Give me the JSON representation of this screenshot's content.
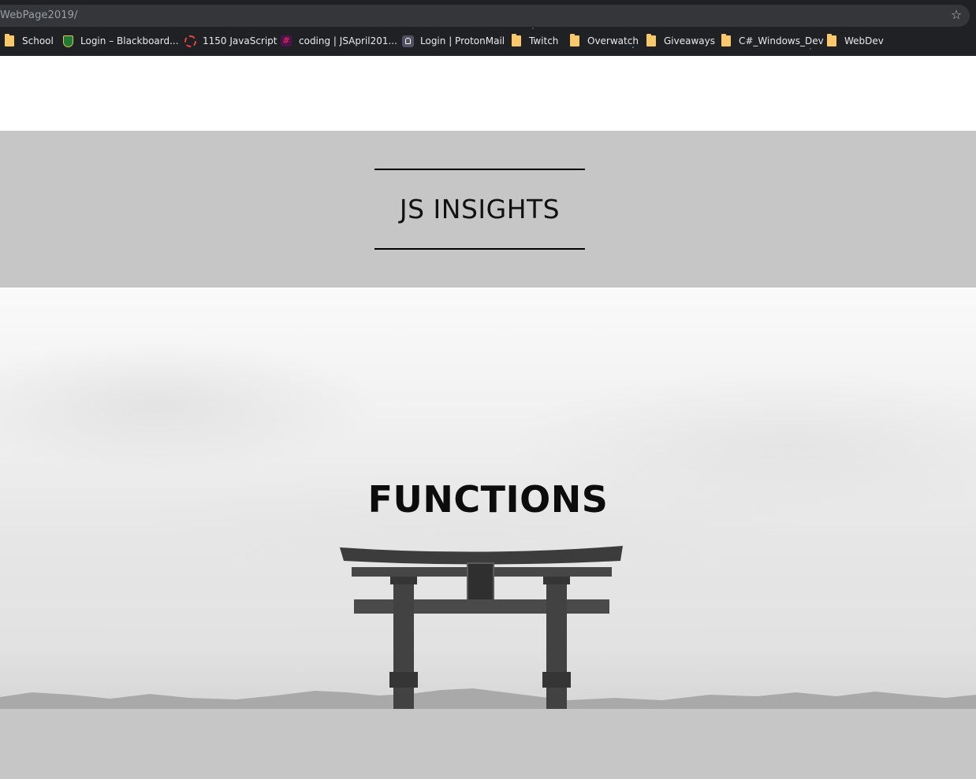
{
  "browser": {
    "url": "WebPage2019/",
    "bookmark_star": "bookmark-star-icon",
    "bookmarks": [
      {
        "label": "School",
        "icon": "folder-icon"
      },
      {
        "label": "Login – Blackboard...",
        "icon": "blackboard-shield-icon"
      },
      {
        "label": "1150 JavaScript",
        "icon": "red-ring-icon"
      },
      {
        "label": "coding | JSApril201...",
        "icon": "slack-icon"
      },
      {
        "label": "Login | ProtonMail",
        "icon": "protonmail-lock-icon"
      },
      {
        "label": "Twitch",
        "icon": "folder-icon"
      },
      {
        "label": "Overwatch",
        "icon": "folder-icon"
      },
      {
        "label": "Giveaways",
        "icon": "folder-icon"
      },
      {
        "label": "C#_Windows_Dev",
        "icon": "folder-icon"
      },
      {
        "label": "WebDev",
        "icon": "folder-icon"
      }
    ]
  },
  "header": {
    "title": "JS INSIGHTS"
  },
  "hero": {
    "title": "FUNCTIONS",
    "image": "torii-gate-on-water-grayscale"
  },
  "colors": {
    "chrome_bg": "#202124",
    "header_bg": "#c6c6c6",
    "folder_yellow": "#f9c969",
    "title_text": "#111111"
  }
}
